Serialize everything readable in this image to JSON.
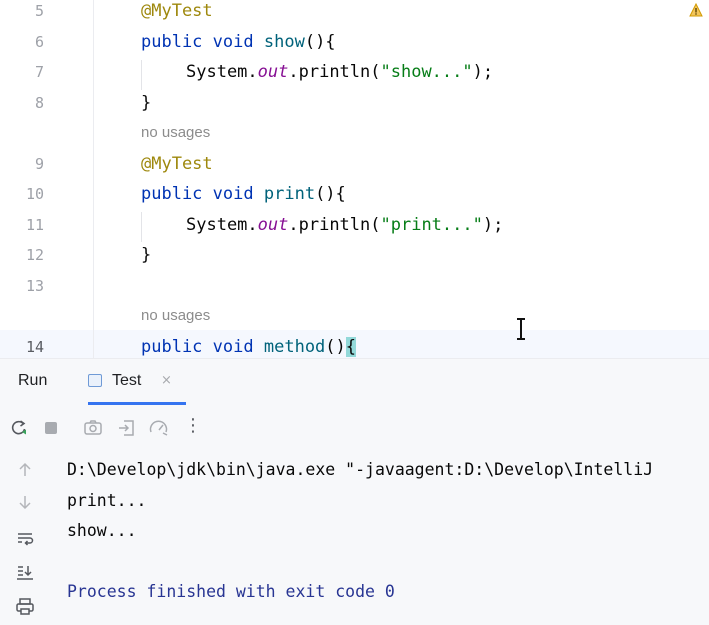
{
  "editor": {
    "rows": [
      {
        "line": "5",
        "parts": [
          {
            "t": "@MyTest",
            "c": "ann"
          }
        ]
      },
      {
        "line": "6",
        "parts": [
          {
            "t": "public",
            "c": "kw"
          },
          {
            "t": " "
          },
          {
            "t": "void",
            "c": "kw"
          },
          {
            "t": " "
          },
          {
            "t": "show",
            "c": "fn"
          },
          {
            "t": "(){"
          }
        ]
      },
      {
        "line": "7",
        "parts": [
          {
            "t": "System."
          },
          {
            "t": "out",
            "c": "fld"
          },
          {
            "t": ".println("
          },
          {
            "t": "\"show...\"",
            "c": "st"
          },
          {
            "t": ");"
          }
        ]
      },
      {
        "line": "8",
        "parts": [
          {
            "t": "}"
          }
        ]
      },
      {
        "hint": "no usages"
      },
      {
        "line": "9",
        "parts": [
          {
            "t": "@MyTest",
            "c": "ann"
          }
        ]
      },
      {
        "line": "10",
        "parts": [
          {
            "t": "public",
            "c": "kw"
          },
          {
            "t": " "
          },
          {
            "t": "void",
            "c": "kw"
          },
          {
            "t": " "
          },
          {
            "t": "print",
            "c": "fn"
          },
          {
            "t": "(){"
          }
        ]
      },
      {
        "line": "11",
        "parts": [
          {
            "t": "System."
          },
          {
            "t": "out",
            "c": "fld"
          },
          {
            "t": ".println("
          },
          {
            "t": "\"print...\"",
            "c": "st"
          },
          {
            "t": ");"
          }
        ]
      },
      {
        "line": "12",
        "parts": [
          {
            "t": "}"
          }
        ]
      },
      {
        "line": "13",
        "parts": []
      },
      {
        "hint": "no usages"
      },
      {
        "line": "14",
        "current": true,
        "parts": [
          {
            "t": "public",
            "c": "kw"
          },
          {
            "t": " "
          },
          {
            "t": "void",
            "c": "kw"
          },
          {
            "t": " "
          },
          {
            "t": "method",
            "c": "fn"
          },
          {
            "t": "()"
          },
          {
            "t": "{",
            "c": "brace-hl"
          }
        ]
      }
    ]
  },
  "run": {
    "title": "Run",
    "tab_label": "Test",
    "tab_close": "×",
    "toolbar_icons": [
      "rerun-icon",
      "stop-icon",
      "camera-icon",
      "exit-icon",
      "coverage-icon",
      "more-icon"
    ],
    "more_glyph": "⋮",
    "side_icons": [
      "arrow-up-icon",
      "arrow-down-icon",
      "soft-wrap-icon",
      "scroll-to-end-icon",
      "print-icon"
    ],
    "console_lines": [
      "D:\\Develop\\jdk\\bin\\java.exe \"-javaagent:D:\\Develop\\IntelliJ",
      "print...",
      "show...",
      "",
      "Process finished with exit code 0"
    ]
  },
  "colors": {
    "keyword": "#0033b3",
    "annotation": "#9e880d",
    "string": "#067d17",
    "field": "#871094",
    "accent": "#3574f0"
  }
}
